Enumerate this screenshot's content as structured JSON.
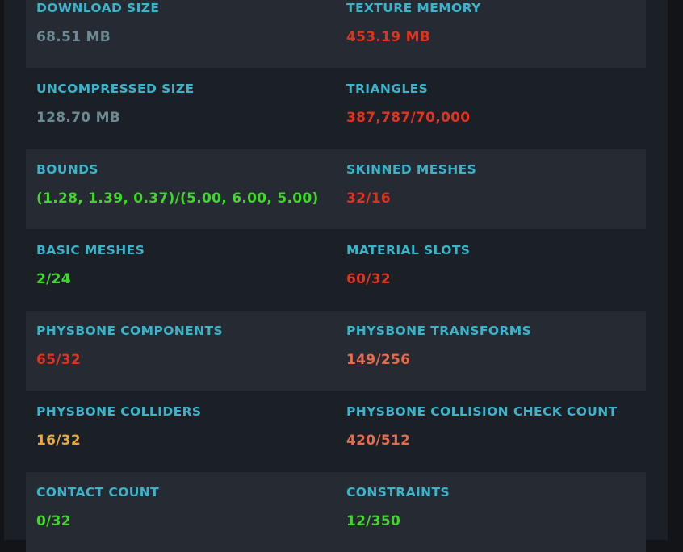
{
  "colors": {
    "label": "#3bb3c8",
    "neutral": "#6b8a92",
    "good": "#3fd82a",
    "warning": "#e8a63b",
    "poor": "#e86a4a",
    "very_poor": "#e0331f"
  },
  "stats": [
    {
      "left": {
        "label": "DOWNLOAD SIZE",
        "value": "68.51 MB",
        "rating": "neutral"
      },
      "right": {
        "label": "TEXTURE MEMORY",
        "value": "453.19 MB",
        "rating": "very_poor"
      }
    },
    {
      "left": {
        "label": "UNCOMPRESSED SIZE",
        "value": "128.70 MB",
        "rating": "neutral"
      },
      "right": {
        "label": "TRIANGLES",
        "value": "387,787/70,000",
        "rating": "very_poor"
      }
    },
    {
      "left": {
        "label": "BOUNDS",
        "value": "(1.28, 1.39, 0.37)/(5.00, 6.00, 5.00)",
        "rating": "good"
      },
      "right": {
        "label": "SKINNED MESHES",
        "value": "32/16",
        "rating": "very_poor"
      }
    },
    {
      "left": {
        "label": "BASIC MESHES",
        "value": "2/24",
        "rating": "good"
      },
      "right": {
        "label": "MATERIAL SLOTS",
        "value": "60/32",
        "rating": "very_poor"
      }
    },
    {
      "left": {
        "label": "PHYSBONE COMPONENTS",
        "value": "65/32",
        "rating": "very_poor"
      },
      "right": {
        "label": "PHYSBONE TRANSFORMS",
        "value": "149/256",
        "rating": "poor"
      }
    },
    {
      "left": {
        "label": "PHYSBONE COLLIDERS",
        "value": "16/32",
        "rating": "warning"
      },
      "right": {
        "label": "PHYSBONE COLLISION CHECK COUNT",
        "value": "420/512",
        "rating": "poor"
      }
    },
    {
      "left": {
        "label": "CONTACT COUNT",
        "value": "0/32",
        "rating": "good"
      },
      "right": {
        "label": "CONSTRAINTS",
        "value": "12/350",
        "rating": "good"
      }
    }
  ]
}
